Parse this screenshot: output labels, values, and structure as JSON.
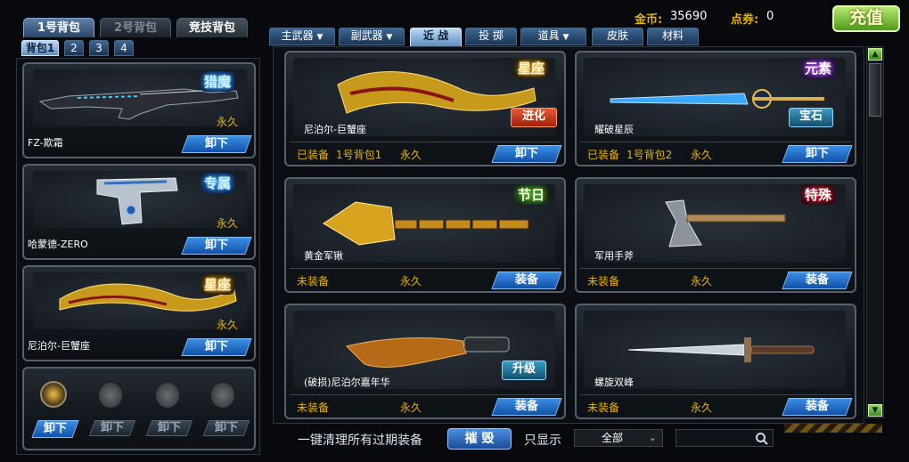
{
  "bag_tabs": [
    "1号背包",
    "2号背包",
    "竞技背包"
  ],
  "sub_bags": [
    "背包1",
    "2",
    "3",
    "4"
  ],
  "currency": {
    "gold_label": "金币:",
    "gold_value": "35690",
    "points_label": "点券:",
    "points_value": "0"
  },
  "recharge_label": "充值",
  "categories": [
    "主武器",
    "副武器",
    "近 战",
    "投 掷",
    "道具",
    "皮肤",
    "材料"
  ],
  "equipped": [
    {
      "name": "FZ-欺霜",
      "badge": "猎魔",
      "duration": "永久",
      "action": "卸下"
    },
    {
      "name": "哈蒙德-ZERO",
      "badge": "专属",
      "duration": "永久",
      "action": "卸下"
    },
    {
      "name": "尼泊尔-巨蟹座",
      "badge": "星座",
      "duration": "永久",
      "action": "卸下"
    }
  ],
  "grenade_slots": [
    "卸下",
    "卸下",
    "卸下",
    "卸下"
  ],
  "items": [
    {
      "name": "尼泊尔-巨蟹座",
      "badge": "星座",
      "tag": "进化",
      "status": "已装备",
      "bag": "1号背包1",
      "duration": "永久",
      "action": "卸下"
    },
    {
      "name": "耀破星辰",
      "badge": "元素",
      "tag": "宝石",
      "status": "已装备",
      "bag": "1号背包2",
      "duration": "永久",
      "action": "卸下"
    },
    {
      "name": "黄金军锹",
      "badge": "节日",
      "tag": "",
      "status": "未装备",
      "bag": "",
      "duration": "永久",
      "action": "装备"
    },
    {
      "name": "军用手斧",
      "badge": "特殊",
      "tag": "",
      "status": "未装备",
      "bag": "",
      "duration": "永久",
      "action": "装备"
    },
    {
      "name": "(破损)尼泊尔嘉年华",
      "badge": "",
      "tag": "升级",
      "status": "未装备",
      "bag": "",
      "duration": "永久",
      "action": "装备"
    },
    {
      "name": "螺旋双峰",
      "badge": "",
      "tag": "",
      "status": "未装备",
      "bag": "",
      "duration": "永久",
      "action": "装备"
    }
  ],
  "footer": {
    "clear_label": "一键清理所有过期装备",
    "destroy_label": "摧 毁",
    "filter_label": "只显示",
    "filter_value": "全部",
    "search_placeholder": ""
  },
  "colors": {
    "accent_gold": "#e6b400",
    "button_blue": "#1f6fd0",
    "tag_red": "#c8301c",
    "tag_teal": "#1b6e92"
  }
}
